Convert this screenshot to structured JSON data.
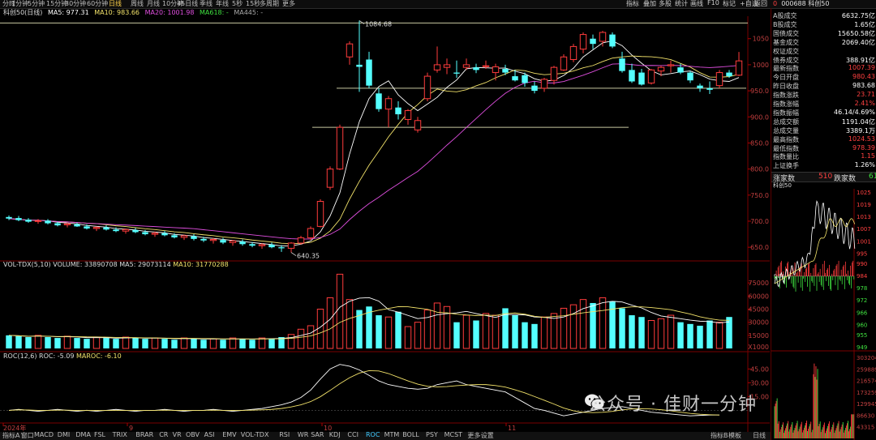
{
  "period_tabs": [
    "分时",
    "1分钟",
    "5分钟",
    "15分钟",
    "30分钟",
    "60分钟",
    "日线",
    "周线",
    "月线",
    "10分钟",
    "45日线",
    "季线",
    "年线",
    "5秒",
    "15秒",
    "多周期",
    "更多"
  ],
  "active_period": "日线",
  "right_tools": [
    "指标",
    "叠加",
    "多股",
    "统计",
    "画线",
    "F10",
    "标记",
    "+自选",
    "返回"
  ],
  "stock": {
    "flag": "0",
    "code": "000688",
    "name": "科创50"
  },
  "legend": {
    "name": "科创50(日线)",
    "ma5": "MA5: 977.31",
    "ma10": "MA10: 983.66",
    "ma20": "MA20: 1001.98",
    "ma618": "MA618: -",
    "ma445": "MA445: -",
    "colors": {
      "ma5": "#ffffff",
      "ma10": "#f2e26a",
      "ma20": "#e04fe0",
      "ma618": "#3fe03f",
      "ma445": "#aaaaaa"
    }
  },
  "kline_labels": {
    "high": "1084.68",
    "low": "640.35"
  },
  "price_axis": [
    "1050",
    "1000",
    "950.0",
    "900.0",
    "850.0",
    "800.0",
    "750.0",
    "700.0",
    "650.0"
  ],
  "vol_legend": {
    "name": "VOL-TDX(5,10)",
    "volume": "VOLUME: 33890708",
    "ma5": "MA5: 29073114",
    "ma10": "MA10: 31770288"
  },
  "vol_axis": [
    "75000",
    "60000",
    "45000",
    "30000",
    "15000",
    "X1000"
  ],
  "roc_legend": {
    "name": "ROC(12,6)",
    "roc": "ROC: -5.09",
    "maroc": "MAROC: -6.10"
  },
  "roc_axis": [
    "45.00",
    "30.00",
    "15.00"
  ],
  "date_axis": [
    "2024年",
    "9",
    "10",
    "11"
  ],
  "quote_rows": [
    {
      "k": "A股成交",
      "v": "6632.75亿",
      "c": "#ffffff"
    },
    {
      "k": "B股成交",
      "v": "1.65亿",
      "c": "#ffffff"
    },
    {
      "k": "国债成交",
      "v": "15650.58亿",
      "c": "#ffffff"
    },
    {
      "k": "基金成交",
      "v": "2069.40亿",
      "c": "#ffffff"
    },
    {
      "k": "权证成交",
      "v": "",
      "c": "#ffffff"
    },
    {
      "k": "债券成交",
      "v": "388.91亿",
      "c": "#ffffff"
    },
    {
      "k": "最新指数",
      "v": "1007.39",
      "c": "#ff4040"
    },
    {
      "k": "今日开盘",
      "v": "980.43",
      "c": "#ff4040"
    },
    {
      "k": "昨日收盘",
      "v": "983.68",
      "c": "#ffffff"
    },
    {
      "k": "指数涨跌",
      "v": "23.71",
      "c": "#ff4040"
    },
    {
      "k": "指数涨幅",
      "v": "2.41%",
      "c": "#ff4040"
    },
    {
      "k": "指数振幅",
      "v": "46.14/4.69%",
      "c": "#ffffff"
    },
    {
      "k": "总成交额",
      "v": "1191.04亿",
      "c": "#ffffff"
    },
    {
      "k": "总成交量",
      "v": "3389.1万",
      "c": "#ffffff"
    },
    {
      "k": "最高指数",
      "v": "1024.53",
      "c": "#ff4040"
    },
    {
      "k": "最低指数",
      "v": "978.39",
      "c": "#ff4040"
    },
    {
      "k": "指数量比",
      "v": "1.15",
      "c": "#ff4040"
    },
    {
      "k": "上证换手",
      "v": "1.26%",
      "c": "#ffffff"
    }
  ],
  "updown": {
    "up_label": "涨家数",
    "up": "510",
    "down_label": "跌家数",
    "down": "61"
  },
  "mini": {
    "title": "科创50",
    "left_axis": [
      "984"
    ],
    "right_axis": [
      "1025",
      "1019",
      "1013",
      "1007",
      "1001",
      "995",
      "990",
      "984",
      "978",
      "972",
      "966",
      "960",
      "955",
      "949"
    ],
    "vol_axis": [
      "303204",
      "259889",
      "216574",
      "173259",
      "129945",
      "86630",
      "43315"
    ]
  },
  "bottom_tabs": [
    "指标A",
    "窗口",
    "MACD",
    "DMI",
    "DMA",
    "FSL",
    "TRIX",
    "BRAR",
    "CR",
    "VR",
    "OBV",
    "ASI",
    "EMV",
    "VOL-TDX",
    "RSI",
    "WR",
    "SAR",
    "KDJ",
    "CCI",
    "ROC",
    "MTM",
    "BOLL",
    "PSY",
    "MCST",
    "更多",
    "设置"
  ],
  "active_bottom": "ROC",
  "bottom_right": [
    "指标B",
    "模板"
  ],
  "mini_bottom": "日线",
  "watermark": "公众号 · 佳财一分钟",
  "chart_data": {
    "type": "candlestick",
    "candles": [
      {
        "o": 708,
        "h": 711,
        "l": 702,
        "c": 705
      },
      {
        "o": 706,
        "h": 710,
        "l": 700,
        "c": 702
      },
      {
        "o": 703,
        "h": 706,
        "l": 697,
        "c": 699
      },
      {
        "o": 700,
        "h": 704,
        "l": 695,
        "c": 701
      },
      {
        "o": 701,
        "h": 704,
        "l": 694,
        "c": 696
      },
      {
        "o": 696,
        "h": 699,
        "l": 690,
        "c": 692
      },
      {
        "o": 693,
        "h": 697,
        "l": 688,
        "c": 695
      },
      {
        "o": 694,
        "h": 697,
        "l": 689,
        "c": 690
      },
      {
        "o": 690,
        "h": 694,
        "l": 684,
        "c": 686
      },
      {
        "o": 686,
        "h": 690,
        "l": 681,
        "c": 688
      },
      {
        "o": 688,
        "h": 692,
        "l": 682,
        "c": 684
      },
      {
        "o": 684,
        "h": 688,
        "l": 679,
        "c": 681
      },
      {
        "o": 681,
        "h": 686,
        "l": 676,
        "c": 684
      },
      {
        "o": 683,
        "h": 687,
        "l": 677,
        "c": 679
      },
      {
        "o": 679,
        "h": 683,
        "l": 673,
        "c": 675
      },
      {
        "o": 675,
        "h": 680,
        "l": 670,
        "c": 677
      },
      {
        "o": 677,
        "h": 681,
        "l": 671,
        "c": 673
      },
      {
        "o": 673,
        "h": 677,
        "l": 667,
        "c": 669
      },
      {
        "o": 669,
        "h": 674,
        "l": 664,
        "c": 672
      },
      {
        "o": 671,
        "h": 675,
        "l": 663,
        "c": 666
      },
      {
        "o": 666,
        "h": 670,
        "l": 660,
        "c": 663
      },
      {
        "o": 663,
        "h": 668,
        "l": 657,
        "c": 665
      },
      {
        "o": 664,
        "h": 668,
        "l": 656,
        "c": 659
      },
      {
        "o": 659,
        "h": 664,
        "l": 653,
        "c": 662
      },
      {
        "o": 661,
        "h": 665,
        "l": 653,
        "c": 656
      },
      {
        "o": 656,
        "h": 660,
        "l": 650,
        "c": 653
      },
      {
        "o": 653,
        "h": 658,
        "l": 647,
        "c": 655
      },
      {
        "o": 655,
        "h": 659,
        "l": 648,
        "c": 650
      },
      {
        "o": 650,
        "h": 654,
        "l": 641,
        "c": 648
      },
      {
        "o": 648,
        "h": 660,
        "l": 640,
        "c": 658
      },
      {
        "o": 658,
        "h": 672,
        "l": 655,
        "c": 668
      },
      {
        "o": 668,
        "h": 690,
        "l": 664,
        "c": 686
      },
      {
        "o": 690,
        "h": 742,
        "l": 688,
        "c": 738
      },
      {
        "o": 765,
        "h": 805,
        "l": 760,
        "c": 800
      },
      {
        "o": 800,
        "h": 885,
        "l": 798,
        "c": 880
      },
      {
        "o": 1015,
        "h": 1045,
        "l": 1000,
        "c": 1040
      },
      {
        "o": 1000,
        "h": 1084.68,
        "l": 948,
        "c": 996
      },
      {
        "o": 1010,
        "h": 1025,
        "l": 955,
        "c": 960
      },
      {
        "o": 945,
        "h": 955,
        "l": 910,
        "c": 915
      },
      {
        "o": 915,
        "h": 940,
        "l": 880,
        "c": 935
      },
      {
        "o": 918,
        "h": 930,
        "l": 895,
        "c": 905
      },
      {
        "o": 895,
        "h": 915,
        "l": 885,
        "c": 912
      },
      {
        "o": 875,
        "h": 900,
        "l": 870,
        "c": 893
      },
      {
        "o": 935,
        "h": 985,
        "l": 930,
        "c": 978
      },
      {
        "o": 990,
        "h": 1035,
        "l": 985,
        "c": 1000
      },
      {
        "o": 995,
        "h": 1012,
        "l": 982,
        "c": 1000
      },
      {
        "o": 985,
        "h": 1008,
        "l": 975,
        "c": 983
      },
      {
        "o": 995,
        "h": 1012,
        "l": 990,
        "c": 1000
      },
      {
        "o": 995,
        "h": 1002,
        "l": 984,
        "c": 990
      },
      {
        "o": 998,
        "h": 1008,
        "l": 992,
        "c": 998
      },
      {
        "o": 985,
        "h": 1002,
        "l": 970,
        "c": 996
      },
      {
        "o": 992,
        "h": 1000,
        "l": 980,
        "c": 985
      },
      {
        "o": 978,
        "h": 990,
        "l": 968,
        "c": 970
      },
      {
        "o": 980,
        "h": 985,
        "l": 958,
        "c": 965
      },
      {
        "o": 960,
        "h": 968,
        "l": 945,
        "c": 950
      },
      {
        "o": 955,
        "h": 975,
        "l": 948,
        "c": 972
      },
      {
        "o": 970,
        "h": 998,
        "l": 962,
        "c": 995
      },
      {
        "o": 990,
        "h": 1020,
        "l": 988,
        "c": 1015
      },
      {
        "o": 1010,
        "h": 1040,
        "l": 1005,
        "c": 1035
      },
      {
        "o": 1030,
        "h": 1062,
        "l": 1022,
        "c": 1058
      },
      {
        "o": 1050,
        "h": 1058,
        "l": 1030,
        "c": 1040
      },
      {
        "o": 1045,
        "h": 1065,
        "l": 1035,
        "c": 1062
      },
      {
        "o": 1058,
        "h": 1062,
        "l": 1032,
        "c": 1035
      },
      {
        "o": 1012,
        "h": 1025,
        "l": 985,
        "c": 988
      },
      {
        "o": 990,
        "h": 1002,
        "l": 965,
        "c": 968
      },
      {
        "o": 985,
        "h": 992,
        "l": 960,
        "c": 962
      },
      {
        "o": 965,
        "h": 992,
        "l": 962,
        "c": 990
      },
      {
        "o": 988,
        "h": 998,
        "l": 978,
        "c": 995
      },
      {
        "o": 998,
        "h": 1008,
        "l": 985,
        "c": 1000
      },
      {
        "o": 995,
        "h": 1002,
        "l": 982,
        "c": 985
      },
      {
        "o": 985,
        "h": 988,
        "l": 965,
        "c": 970
      },
      {
        "o": 960,
        "h": 964,
        "l": 948,
        "c": 955
      },
      {
        "o": 955,
        "h": 968,
        "l": 944,
        "c": 952
      },
      {
        "o": 960,
        "h": 990,
        "l": 955,
        "c": 985
      },
      {
        "o": 985,
        "h": 990,
        "l": 975,
        "c": 978
      },
      {
        "o": 980,
        "h": 1024.53,
        "l": 978.39,
        "c": 1007.39
      }
    ],
    "volume_k": [
      15,
      14,
      13,
      15,
      13,
      12,
      14,
      12,
      11,
      13,
      12,
      11,
      13,
      12,
      11,
      12,
      11,
      10,
      12,
      11,
      10,
      11,
      10,
      12,
      11,
      10,
      12,
      11,
      13,
      16,
      22,
      26,
      45,
      58,
      85,
      56,
      44,
      48,
      38,
      36,
      42,
      25,
      30,
      44,
      52,
      48,
      30,
      38,
      32,
      40,
      38,
      46,
      38,
      30,
      28,
      36,
      40,
      46,
      50,
      56,
      52,
      58,
      54,
      46,
      38,
      36,
      32,
      34,
      38,
      30,
      28,
      26,
      32,
      30,
      36
    ],
    "roc": [
      0,
      1,
      0,
      -1,
      0,
      1,
      0,
      -1,
      0,
      -1,
      0,
      1,
      0,
      -1,
      0,
      0,
      1,
      0,
      -1,
      0,
      0,
      1,
      0,
      -1,
      0,
      1,
      2,
      4,
      6,
      9,
      14,
      22,
      34,
      45,
      50,
      48,
      44,
      38,
      32,
      28,
      26,
      24,
      23,
      24,
      28,
      30,
      32,
      28,
      26,
      24,
      22,
      20,
      14,
      8,
      2,
      0,
      -3,
      -6,
      -4,
      -2,
      0,
      2,
      3,
      4,
      2,
      0,
      -2,
      -3,
      -4,
      -5,
      -6,
      -5.5,
      -5.1,
      -5.09
    ],
    "ylim": [
      630,
      1090
    ],
    "vol_ylim": [
      0,
      90
    ],
    "roc_ylim": [
      -12,
      55
    ]
  }
}
